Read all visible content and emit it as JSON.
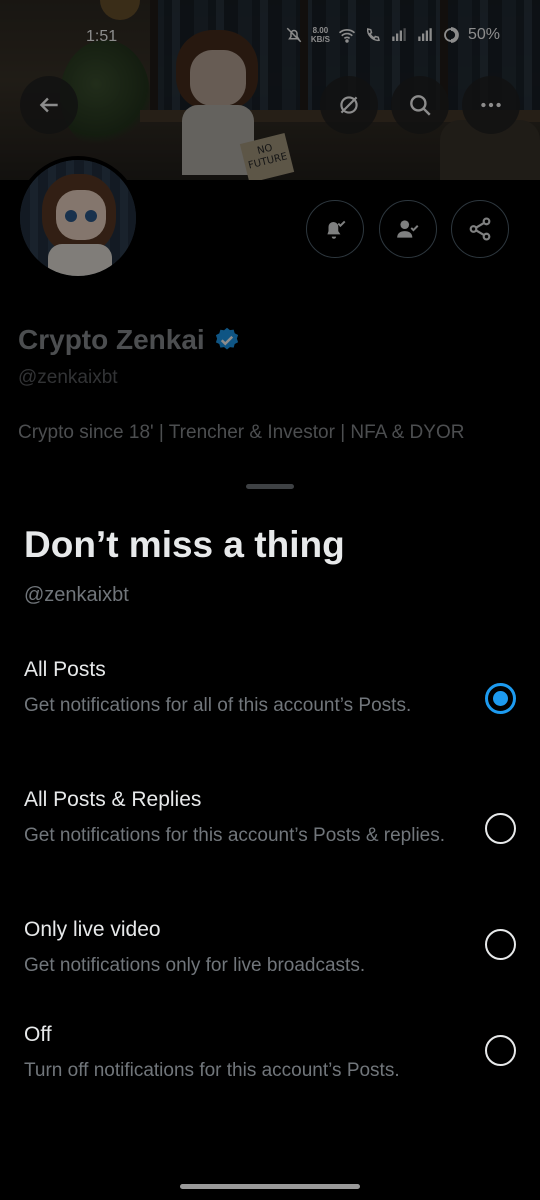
{
  "status_bar": {
    "time": "1:51",
    "net_speed_value": "8.00",
    "net_speed_unit": "KB/S",
    "battery": "50%"
  },
  "banner": {
    "sign_text": "NO FUTURE"
  },
  "header_buttons": [
    {
      "icon": "back-arrow-icon"
    },
    {
      "icon": "grok-icon"
    },
    {
      "icon": "search-icon"
    },
    {
      "icon": "more-icon"
    }
  ],
  "profile": {
    "name": "Crypto Zenkai",
    "handle": "@zenkaixbt",
    "bio": "Crypto since 18' | Trencher & Investor | NFA & DYOR",
    "verified_color": "#1d9bf0"
  },
  "profile_actions": [
    {
      "icon": "bell-check-icon"
    },
    {
      "icon": "person-check-icon"
    },
    {
      "icon": "share-icon"
    }
  ],
  "sheet": {
    "title": "Don’t miss a thing",
    "handle": "@zenkaixbt",
    "options": [
      {
        "title": "All Posts",
        "description": "Get notifications for all of this account’s Posts.",
        "selected": true
      },
      {
        "title": "All Posts & Replies",
        "description": "Get notifications for this account’s Posts & replies.",
        "selected": false
      },
      {
        "title": "Only live video",
        "description": "Get notifications only for live broadcasts.",
        "selected": false
      },
      {
        "title": "Off",
        "description": "Turn off notifications for this account’s Posts.",
        "selected": false
      }
    ]
  },
  "colors": {
    "accent": "#1d9bf0",
    "background": "#000000",
    "text_primary": "#e7e9ea",
    "text_secondary": "#71767b"
  }
}
